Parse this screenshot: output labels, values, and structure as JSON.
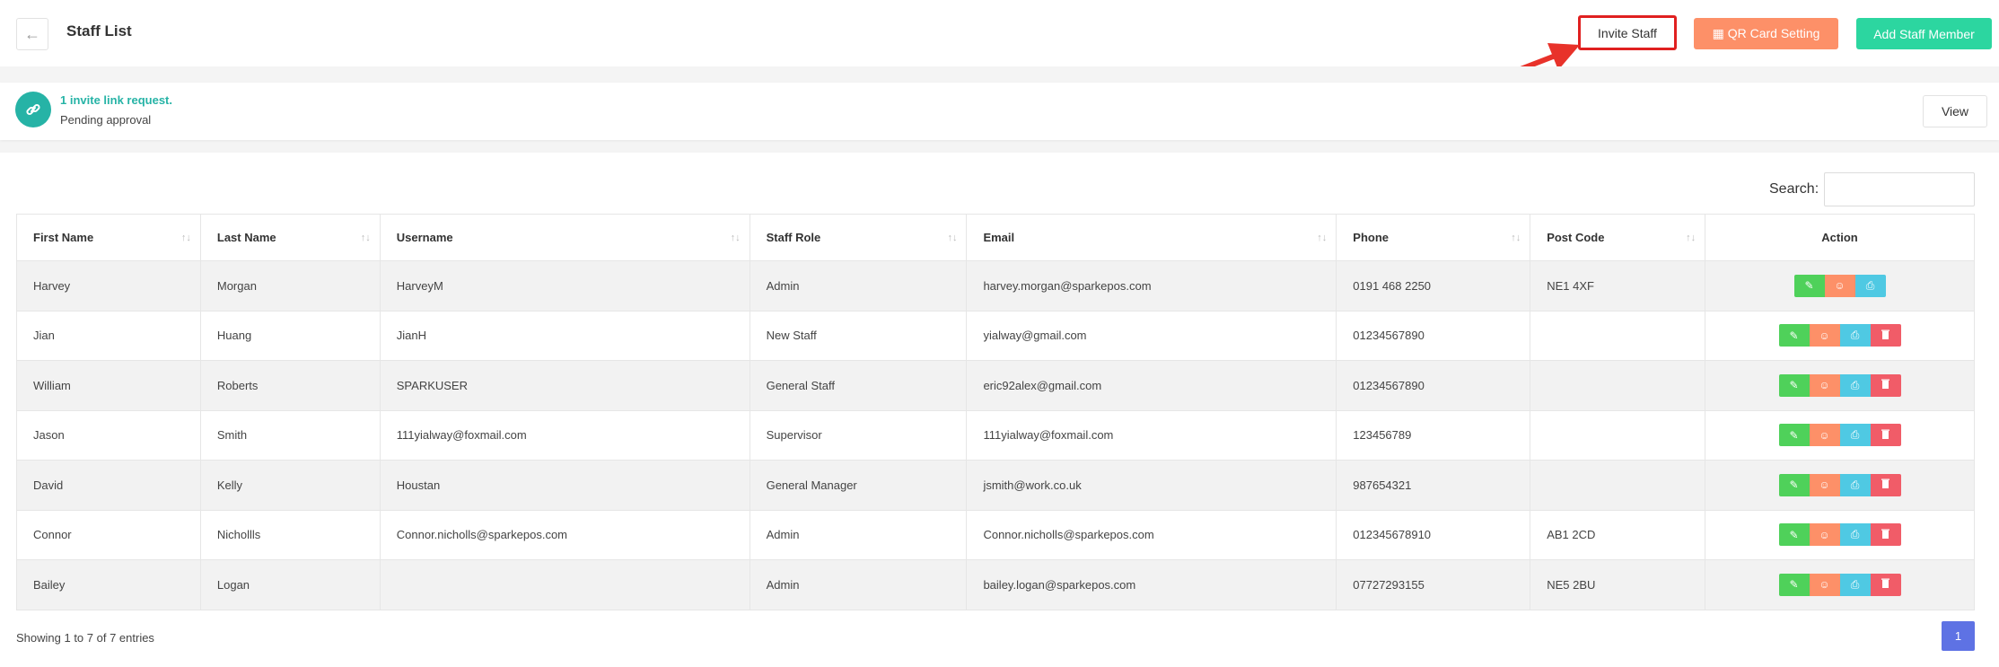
{
  "header": {
    "title": "Staff List",
    "back_icon": "←",
    "invite_label": "Invite Staff",
    "qr_label": "▦ QR Card Setting",
    "add_label": "Add Staff Member"
  },
  "colors": {
    "accent_teal": "#26b3a6",
    "qr_orange": "#fd9068",
    "add_green": "#2cd6a0",
    "highlight_red": "#e02020",
    "page_blue": "#5e72e4"
  },
  "invite_notice": {
    "icon": "link-icon",
    "title": "1 invite link request.",
    "subtitle": "Pending approval",
    "view_label": "View"
  },
  "search": {
    "label": "Search:",
    "value": ""
  },
  "table": {
    "columns": [
      "First Name",
      "Last Name",
      "Username",
      "Staff Role",
      "Email",
      "Phone",
      "Post Code",
      "Action"
    ],
    "rows": [
      {
        "first": "Harvey",
        "last": "Morgan",
        "username": "HarveyM",
        "role": "Admin",
        "email": "harvey.morgan@sparkepos.com",
        "phone": "0191 468 2250",
        "postcode": "NE1 4XF",
        "deletable": false
      },
      {
        "first": "Jian",
        "last": "Huang",
        "username": "JianH",
        "role": "New Staff",
        "email": "yialway@gmail.com",
        "phone": "01234567890",
        "postcode": "",
        "deletable": true
      },
      {
        "first": "William",
        "last": "Roberts",
        "username": "SPARKUSER",
        "role": "General Staff",
        "email": "eric92alex@gmail.com",
        "phone": "01234567890",
        "postcode": "",
        "deletable": true
      },
      {
        "first": "Jason",
        "last": "Smith",
        "username": "111yialway@foxmail.com",
        "role": "Supervisor",
        "email": "111yialway@foxmail.com",
        "phone": "123456789",
        "postcode": "",
        "deletable": true
      },
      {
        "first": "David",
        "last": "Kelly",
        "username": "Houstan",
        "role": "General Manager",
        "email": "jsmith@work.co.uk",
        "phone": "987654321",
        "postcode": "",
        "deletable": true
      },
      {
        "first": "Connor",
        "last": "Nichollls",
        "username": "Connor.nicholls@sparkepos.com",
        "role": "Admin",
        "email": "Connor.nicholls@sparkepos.com",
        "phone": "012345678910",
        "postcode": "AB1 2CD",
        "deletable": true
      },
      {
        "first": "Bailey",
        "last": "Logan",
        "username": "",
        "role": "Admin",
        "email": "bailey.logan@sparkepos.com",
        "phone": "07727293155",
        "postcode": "NE5 2BU",
        "deletable": true
      }
    ]
  },
  "footer": {
    "showing": "Showing 1 to 7 of 7 entries",
    "page": "1"
  }
}
